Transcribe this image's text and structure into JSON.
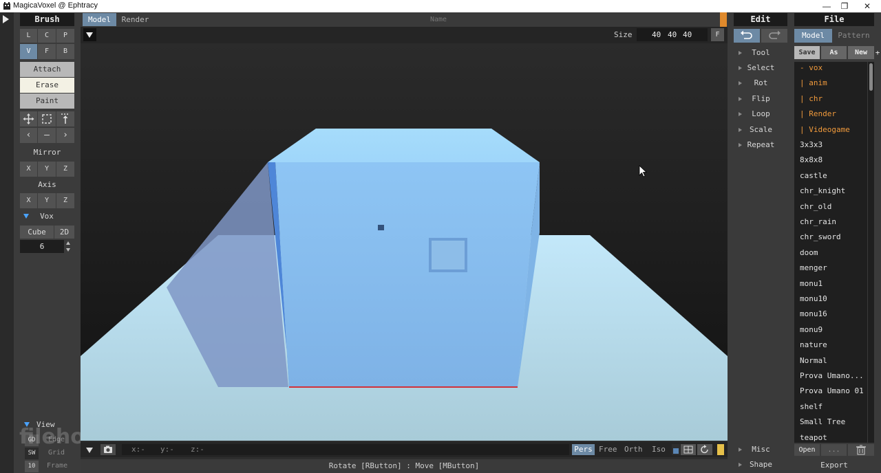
{
  "window": {
    "title": "MagicaVoxel @ Ephtracy",
    "minimize_glyph": "—",
    "maximize_glyph": "❐",
    "close_glyph": "✕"
  },
  "brush": {
    "header": "Brush",
    "modes_row1": [
      "L",
      "C",
      "P"
    ],
    "modes_row2": [
      "V",
      "F",
      "B"
    ],
    "selected_mode": "V",
    "actions": [
      "Attach",
      "Erase",
      "Paint"
    ],
    "selected_action": "Erase",
    "tool_icons": [
      "move-icon",
      "select-box-icon",
      "align-top-icon"
    ],
    "nav_icons": [
      "chevron-left-icon",
      "minus-icon",
      "chevron-right-icon"
    ],
    "mirror_label": "Mirror",
    "mirror_axes": [
      "X",
      "Y",
      "Z"
    ],
    "axis_label": "Axis",
    "axis_axes": [
      "X",
      "Y",
      "Z"
    ],
    "vox_label": "Vox",
    "vox_shape": "Cube",
    "vox_2d": "2D",
    "vox_size": "6",
    "view_label": "View",
    "view_options": [
      {
        "key": "GD",
        "label": "Edge"
      },
      {
        "key": "SW",
        "label": "Grid"
      },
      {
        "key": "10",
        "label": "Frame"
      }
    ]
  },
  "viewport": {
    "tabs": [
      "Model",
      "Render"
    ],
    "selected_tab": "Model",
    "name_label": "Name",
    "size_label": "Size",
    "size_values": [
      "40",
      "40",
      "40"
    ],
    "f_button": "F",
    "coords": {
      "x": "x:-",
      "y": "y:-",
      "z": "z:-"
    },
    "camera_modes": [
      "Pers",
      "Free",
      "Orth",
      "Iso"
    ],
    "selected_camera": "Pers",
    "status": "Rotate [RButton] : Move [MButton]",
    "watermark": "filehorse.com"
  },
  "edit": {
    "header": "Edit",
    "undo_icon": "undo-icon",
    "redo_icon": "redo-icon",
    "items": [
      "Tool",
      "Select",
      "Rot",
      "Flip",
      "Loop",
      "Scale",
      "Repeat"
    ],
    "bottom_items": [
      "Misc",
      "Shape"
    ]
  },
  "file": {
    "header": "File",
    "tabs": [
      "Model",
      "Pattern"
    ],
    "selected_tab": "Model",
    "actions": [
      "Save",
      "As",
      "New"
    ],
    "plus": "+",
    "items": [
      {
        "name": "- vox",
        "folder": true
      },
      {
        "name": " | anim",
        "folder": true
      },
      {
        "name": " | chr",
        "folder": true
      },
      {
        "name": " | Render",
        "folder": true
      },
      {
        "name": " | Videogame",
        "folder": true
      },
      {
        "name": "3x3x3",
        "folder": false
      },
      {
        "name": "8x8x8",
        "folder": false
      },
      {
        "name": "castle",
        "folder": false
      },
      {
        "name": "chr_knight",
        "folder": false
      },
      {
        "name": "chr_old",
        "folder": false
      },
      {
        "name": "chr_rain",
        "folder": false
      },
      {
        "name": "chr_sword",
        "folder": false
      },
      {
        "name": "doom",
        "folder": false
      },
      {
        "name": "menger",
        "folder": false
      },
      {
        "name": "monu1",
        "folder": false
      },
      {
        "name": "monu10",
        "folder": false
      },
      {
        "name": "monu16",
        "folder": false
      },
      {
        "name": "monu9",
        "folder": false
      },
      {
        "name": "nature",
        "folder": false
      },
      {
        "name": "Normal",
        "folder": false
      },
      {
        "name": "Prova Umano...",
        "folder": false
      },
      {
        "name": "Prova Umano 01",
        "folder": false
      },
      {
        "name": "shelf",
        "folder": false
      },
      {
        "name": "Small Tree",
        "folder": false
      },
      {
        "name": "teapot",
        "folder": false
      }
    ],
    "open_label": "Open",
    "more_label": "...",
    "export_label": "Export"
  },
  "colors": {
    "accent": "#6d8aa5",
    "folder": "#f09a3c",
    "cube": "#8cc3f4",
    "floor": "#cde9f5"
  }
}
